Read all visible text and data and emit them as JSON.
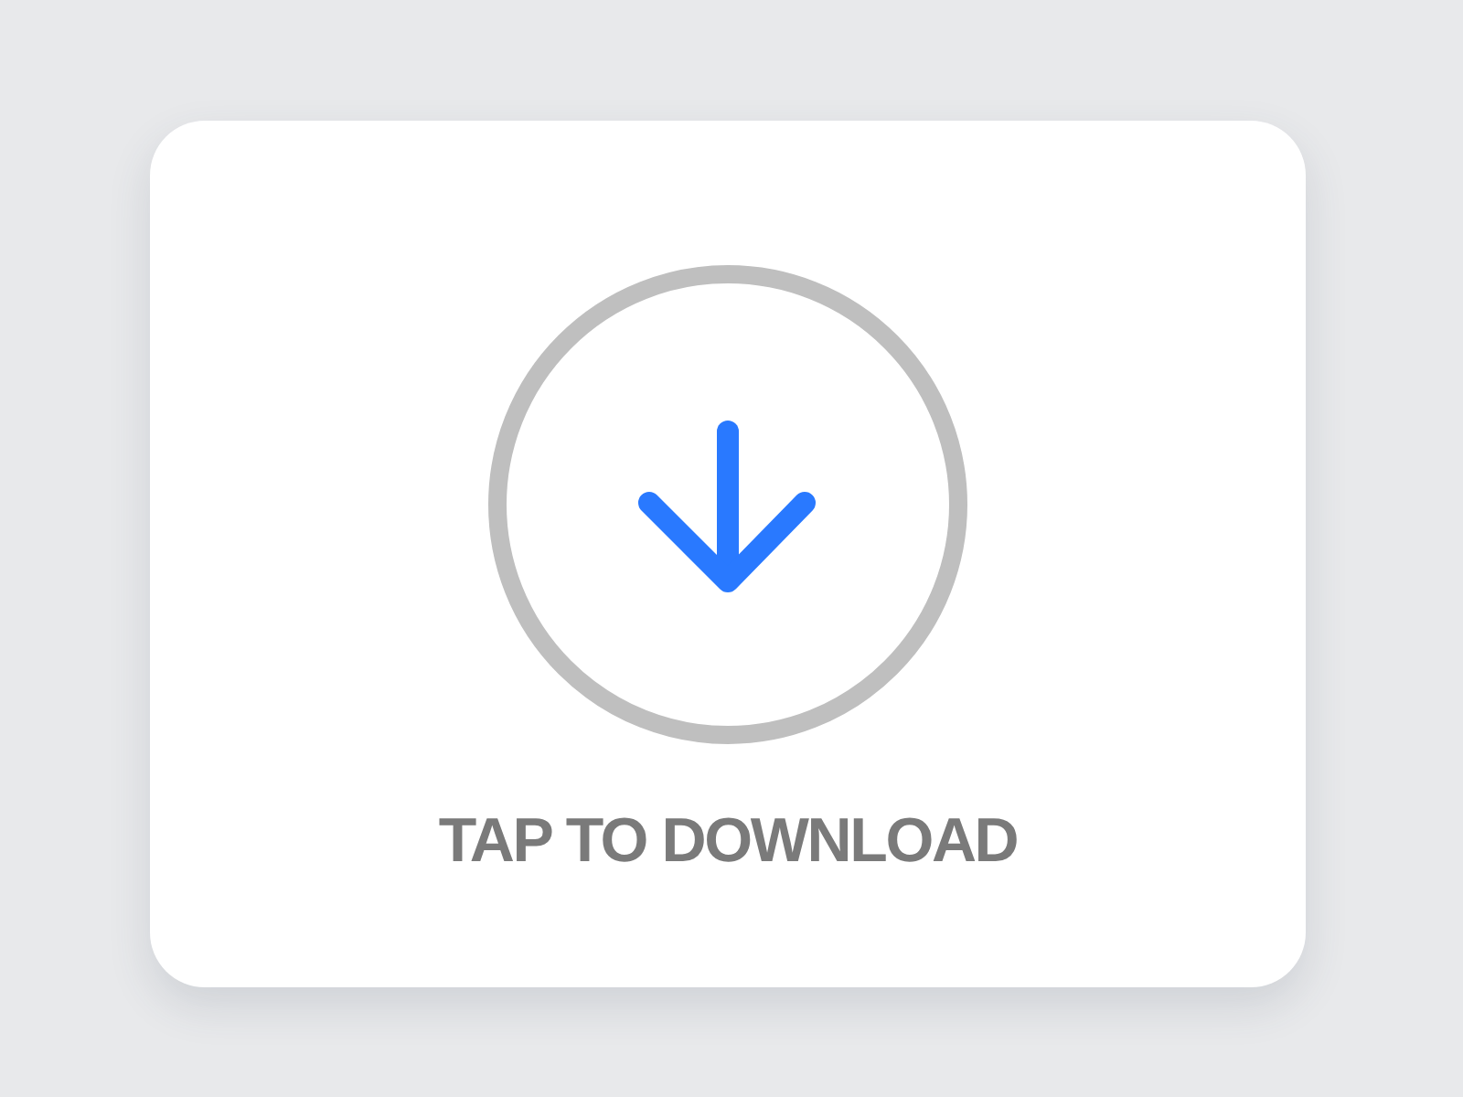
{
  "download_card": {
    "label": "TAP TO DOWNLOAD"
  }
}
